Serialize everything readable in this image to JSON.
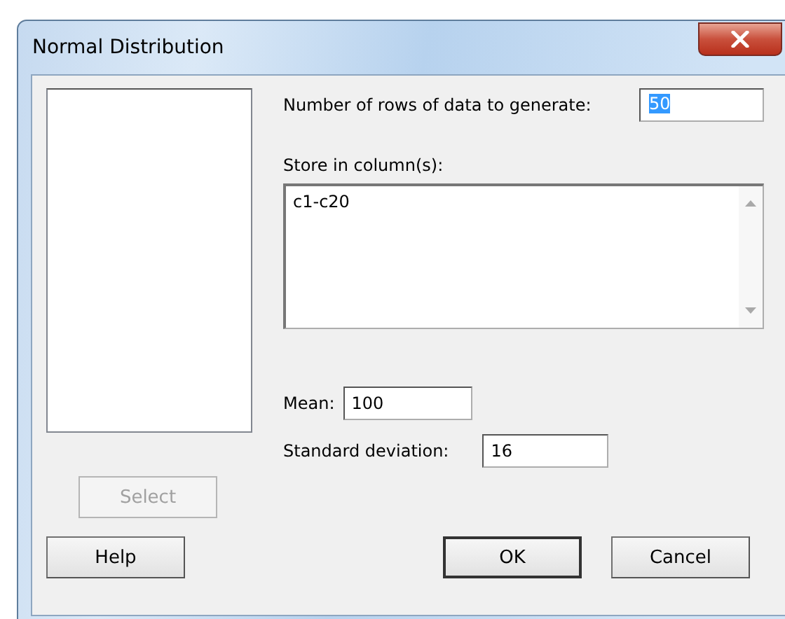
{
  "window": {
    "title": "Normal Distribution"
  },
  "variables_list": {
    "disabled": false
  },
  "rows_field": {
    "label": "Number of rows of data to generate:",
    "value": "50",
    "selected": true
  },
  "store_field": {
    "label": "Store in column(s):",
    "value": "c1-c20"
  },
  "mean_field": {
    "label": "Mean:",
    "value": "100"
  },
  "sd_field": {
    "label": "Standard deviation:",
    "value": "16"
  },
  "select_button": {
    "label": "Select",
    "disabled": true
  },
  "buttons": [
    {
      "label": "Help",
      "default": false
    },
    {
      "label": "OK",
      "default": true
    },
    {
      "label": "Cancel",
      "default": false
    }
  ]
}
